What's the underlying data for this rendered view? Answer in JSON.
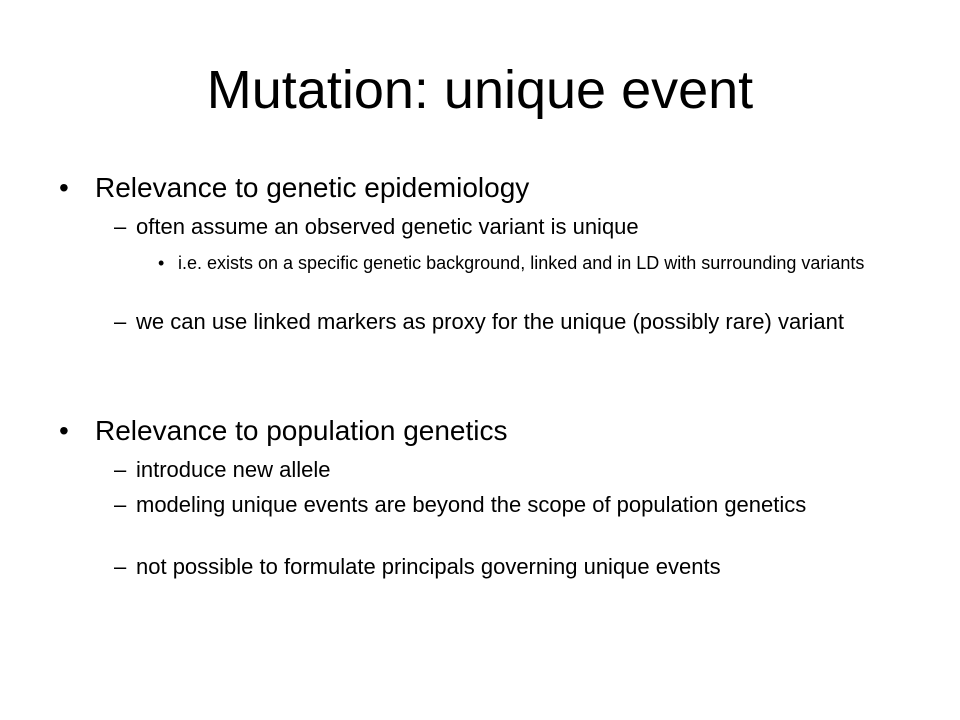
{
  "slide": {
    "title": "Mutation:  unique event",
    "sections": [
      {
        "bullet": "•",
        "heading": "Relevance to genetic epidemiology",
        "items": [
          {
            "marker": "–",
            "text": "often assume an observed genetic variant is unique",
            "subitems": [
              {
                "marker": "•",
                "text": "i.e. exists on a specific genetic background, linked and in LD with surrounding variants"
              }
            ]
          },
          {
            "marker": "–",
            "text": " we can use linked markers as proxy for the unique (possibly rare) variant"
          }
        ]
      },
      {
        "bullet": "•",
        "heading": "Relevance to population genetics",
        "items": [
          {
            "marker": "–",
            "text": "introduce new allele"
          },
          {
            "marker": "–",
            "text": "modeling unique events are beyond the scope of population genetics"
          },
          {
            "marker": "–",
            "text": "not possible to formulate principals governing unique events"
          }
        ]
      }
    ]
  }
}
